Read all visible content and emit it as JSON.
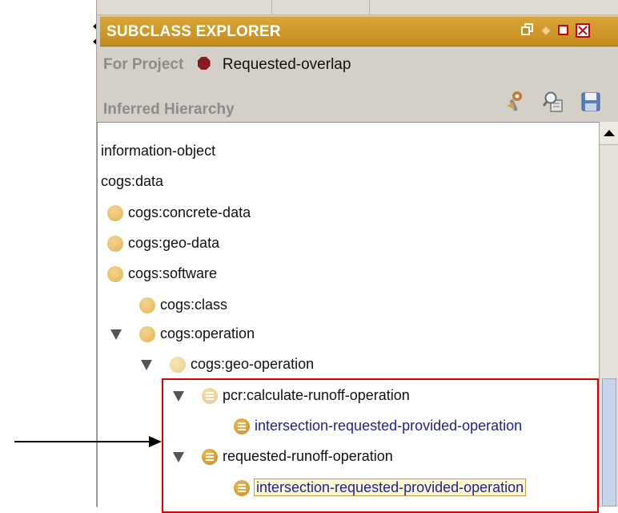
{
  "panel": {
    "title": "SUBCLASS EXPLORER",
    "project_label": "For Project",
    "project_name": "Requested-overlap",
    "hierarchy_label": "Inferred Hierarchy"
  },
  "title_buttons": [
    "restore-icon",
    "pin-icon",
    "maximize-icon",
    "close-icon"
  ],
  "toolbar_icons": [
    "wrench-icon",
    "search-icon",
    "save-icon"
  ],
  "tree_items": [
    {
      "label": "information-object",
      "icon": "none",
      "expanded": false
    },
    {
      "label": "cogs:data",
      "icon": "none",
      "expanded": false
    },
    {
      "label": "cogs:concrete-data",
      "icon": "class-dot",
      "expanded": false
    },
    {
      "label": "cogs:geo-data",
      "icon": "class-dot",
      "expanded": false
    },
    {
      "label": "cogs:software",
      "icon": "class-dot",
      "expanded": false
    },
    {
      "label": "cogs:class",
      "icon": "class-dot",
      "expanded": false
    },
    {
      "label": "cogs:operation",
      "icon": "class-dot",
      "expanded": true
    },
    {
      "label": "cogs:geo-operation",
      "icon": "class-dot",
      "expanded": true
    },
    {
      "label": "pcr:calculate-runoff-operation",
      "icon": "defined-class",
      "expanded": true
    },
    {
      "label": "intersection-requested-provided-operation",
      "icon": "defined-class",
      "expanded": false
    },
    {
      "label": "requested-runoff-operation",
      "icon": "defined-class",
      "expanded": true
    },
    {
      "label": "intersection-requested-provided-operation",
      "icon": "defined-class",
      "expanded": false,
      "selected": true
    }
  ],
  "colors": {
    "titlebar": "#c58c1a",
    "highlight_box": "#e00000",
    "link_text": "#1f1f9c"
  }
}
